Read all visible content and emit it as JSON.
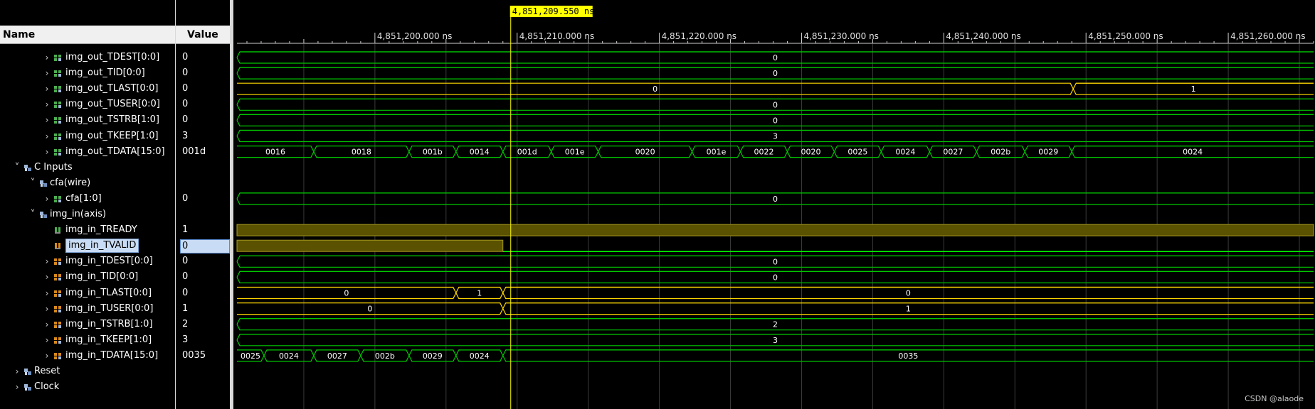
{
  "headers": {
    "name": "Name",
    "value": "Value"
  },
  "cursor_time": "4,851,209.550 ns",
  "time_ticks": [
    "4,851,200.000 ns",
    "4,851,210.000 ns",
    "4,851,220.000 ns",
    "4,851,230.000 ns",
    "4,851,240.000 ns",
    "4,851,250.000 ns",
    "4,851,260.000 ns"
  ],
  "signals": [
    {
      "name": "img_out_TDEST[0:0]",
      "value": "0",
      "kind": "bus",
      "color": "green",
      "indent": 1
    },
    {
      "name": "img_out_TID[0:0]",
      "value": "0",
      "kind": "bus",
      "color": "green",
      "indent": 1
    },
    {
      "name": "img_out_TLAST[0:0]",
      "value": "0",
      "kind": "bus",
      "color": "green",
      "indent": 1
    },
    {
      "name": "img_out_TUSER[0:0]",
      "value": "0",
      "kind": "bus",
      "color": "green",
      "indent": 1
    },
    {
      "name": "img_out_TSTRB[1:0]",
      "value": "0",
      "kind": "bus",
      "color": "green",
      "indent": 1
    },
    {
      "name": "img_out_TKEEP[1:0]",
      "value": "3",
      "kind": "bus",
      "color": "green",
      "indent": 1
    },
    {
      "name": "img_out_TDATA[15:0]",
      "value": "001d",
      "kind": "bus",
      "color": "green",
      "indent": 1
    },
    {
      "name": "C Inputs",
      "value": "",
      "kind": "group",
      "indent": 0
    },
    {
      "name": "cfa(wire)",
      "value": "",
      "kind": "group",
      "indent": 1
    },
    {
      "name": "cfa[1:0]",
      "value": "0",
      "kind": "bus",
      "color": "green",
      "indent": 2
    },
    {
      "name": "img_in(axis)",
      "value": "",
      "kind": "group",
      "indent": 1
    },
    {
      "name": "img_in_TREADY",
      "value": "1",
      "kind": "bit",
      "color": "green",
      "indent": 2
    },
    {
      "name": "img_in_TVALID",
      "value": "0",
      "kind": "bit",
      "color": "orange",
      "indent": 2,
      "selected": true
    },
    {
      "name": "img_in_TDEST[0:0]",
      "value": "0",
      "kind": "bus",
      "color": "orange",
      "indent": 2
    },
    {
      "name": "img_in_TID[0:0]",
      "value": "0",
      "kind": "bus",
      "color": "orange",
      "indent": 2
    },
    {
      "name": "img_in_TLAST[0:0]",
      "value": "0",
      "kind": "bus",
      "color": "orange",
      "indent": 2
    },
    {
      "name": "img_in_TUSER[0:0]",
      "value": "1",
      "kind": "bus",
      "color": "orange",
      "indent": 2
    },
    {
      "name": "img_in_TSTRB[1:0]",
      "value": "2",
      "kind": "bus",
      "color": "orange",
      "indent": 2
    },
    {
      "name": "img_in_TKEEP[1:0]",
      "value": "3",
      "kind": "bus",
      "color": "orange",
      "indent": 2
    },
    {
      "name": "img_in_TDATA[15:0]",
      "value": "0035",
      "kind": "bus",
      "color": "orange",
      "indent": 2
    },
    {
      "name": "Reset",
      "value": "",
      "kind": "group",
      "indent": 0,
      "collapsed": true
    },
    {
      "name": "Clock",
      "value": "",
      "kind": "group",
      "indent": 0,
      "collapsed": true
    }
  ],
  "waves": {
    "timebase": {
      "start_ns": 4851190.3,
      "end_ns": 4851266.0
    },
    "cursor_ns": 4851209.55,
    "rows": [
      {
        "segments": [
          {
            "from": 4851190.3,
            "to": 4851266.0,
            "label": "0"
          }
        ]
      },
      {
        "segments": [
          {
            "from": 4851190.3,
            "to": 4851266.0,
            "label": "0"
          }
        ]
      },
      {
        "segments": [
          {
            "from": 4851190.3,
            "to": 4851249.1,
            "label": "0"
          },
          {
            "from": 4851249.1,
            "to": 4851266.0,
            "label": "1"
          }
        ]
      },
      {
        "segments": [
          {
            "from": 4851190.3,
            "to": 4851266.0,
            "label": "0"
          }
        ]
      },
      {
        "segments": [
          {
            "from": 4851190.3,
            "to": 4851266.0,
            "label": "0"
          }
        ]
      },
      {
        "segments": [
          {
            "from": 4851190.3,
            "to": 4851266.0,
            "label": "3"
          }
        ]
      },
      {
        "segments": [
          {
            "from": 4851190.3,
            "to": 4851195.7,
            "label": "0016"
          },
          {
            "from": 4851195.7,
            "to": 4851202.4,
            "label": "0018"
          },
          {
            "from": 4851202.4,
            "to": 4851205.7,
            "label": "001b"
          },
          {
            "from": 4851205.7,
            "to": 4851209.0,
            "label": "0014"
          },
          {
            "from": 4851209.0,
            "to": 4851212.4,
            "label": "001d"
          },
          {
            "from": 4851212.4,
            "to": 4851215.7,
            "label": "001e"
          },
          {
            "from": 4851215.7,
            "to": 4851222.3,
            "label": "0020"
          },
          {
            "from": 4851222.3,
            "to": 4851225.7,
            "label": "001e"
          },
          {
            "from": 4851225.7,
            "to": 4851229.0,
            "label": "0022"
          },
          {
            "from": 4851229.0,
            "to": 4851232.3,
            "label": "0020"
          },
          {
            "from": 4851232.3,
            "to": 4851235.6,
            "label": "0025"
          },
          {
            "from": 4851235.6,
            "to": 4851239.0,
            "label": "0024"
          },
          {
            "from": 4851239.0,
            "to": 4851242.3,
            "label": "0027"
          },
          {
            "from": 4851242.3,
            "to": 4851245.7,
            "label": "002b"
          },
          {
            "from": 4851245.7,
            "to": 4851249.0,
            "label": "0029"
          },
          {
            "from": 4851249.0,
            "to": 4851266.0,
            "label": "0024"
          }
        ]
      },
      {
        "segments": []
      },
      {
        "segments": []
      },
      {
        "segments": [
          {
            "from": 4851190.3,
            "to": 4851266.0,
            "label": "0"
          }
        ]
      },
      {
        "segments": []
      },
      {
        "level": [
          {
            "from": 4851190.3,
            "to": 4851266.0,
            "high": true
          }
        ]
      },
      {
        "level": [
          {
            "from": 4851190.3,
            "to": 4851209.0,
            "high": true
          },
          {
            "from": 4851209.0,
            "to": 4851266.0,
            "high": false
          }
        ]
      },
      {
        "segments": [
          {
            "from": 4851190.3,
            "to": 4851266.0,
            "label": "0"
          }
        ]
      },
      {
        "segments": [
          {
            "from": 4851190.3,
            "to": 4851266.0,
            "label": "0"
          }
        ]
      },
      {
        "segments": [
          {
            "from": 4851190.3,
            "to": 4851205.7,
            "label": "0"
          },
          {
            "from": 4851205.7,
            "to": 4851209.0,
            "label": "1"
          },
          {
            "from": 4851209.0,
            "to": 4851266.0,
            "label": "0"
          }
        ]
      },
      {
        "segments": [
          {
            "from": 4851190.3,
            "to": 4851209.0,
            "label": "0"
          },
          {
            "from": 4851209.0,
            "to": 4851266.0,
            "label": "1"
          }
        ]
      },
      {
        "segments": [
          {
            "from": 4851190.3,
            "to": 4851266.0,
            "label": "2"
          }
        ]
      },
      {
        "segments": [
          {
            "from": 4851190.3,
            "to": 4851266.0,
            "label": "3"
          }
        ]
      },
      {
        "segments": [
          {
            "from": 4851190.3,
            "to": 4851192.2,
            "label": "0025"
          },
          {
            "from": 4851192.2,
            "to": 4851195.7,
            "label": "0024"
          },
          {
            "from": 4851195.7,
            "to": 4851199.0,
            "label": "0027"
          },
          {
            "from": 4851199.0,
            "to": 4851202.4,
            "label": "002b"
          },
          {
            "from": 4851202.4,
            "to": 4851205.7,
            "label": "0029"
          },
          {
            "from": 4851205.7,
            "to": 4851209.0,
            "label": "0024"
          },
          {
            "from": 4851209.0,
            "to": 4851266.0,
            "label": "0035"
          }
        ]
      },
      {
        "segments": []
      },
      {
        "segments": []
      }
    ]
  },
  "colors": {
    "bus": "#00c800",
    "bit_fill": "#5a5200",
    "bit_line": "#00ff00",
    "cursor": "#ffff00",
    "grid": "#3a3a3a",
    "label_bg": "#ffff00",
    "orange_icon": "#d88a1e",
    "green_icon": "#4caf50"
  },
  "footer": "CSDN @alaode"
}
